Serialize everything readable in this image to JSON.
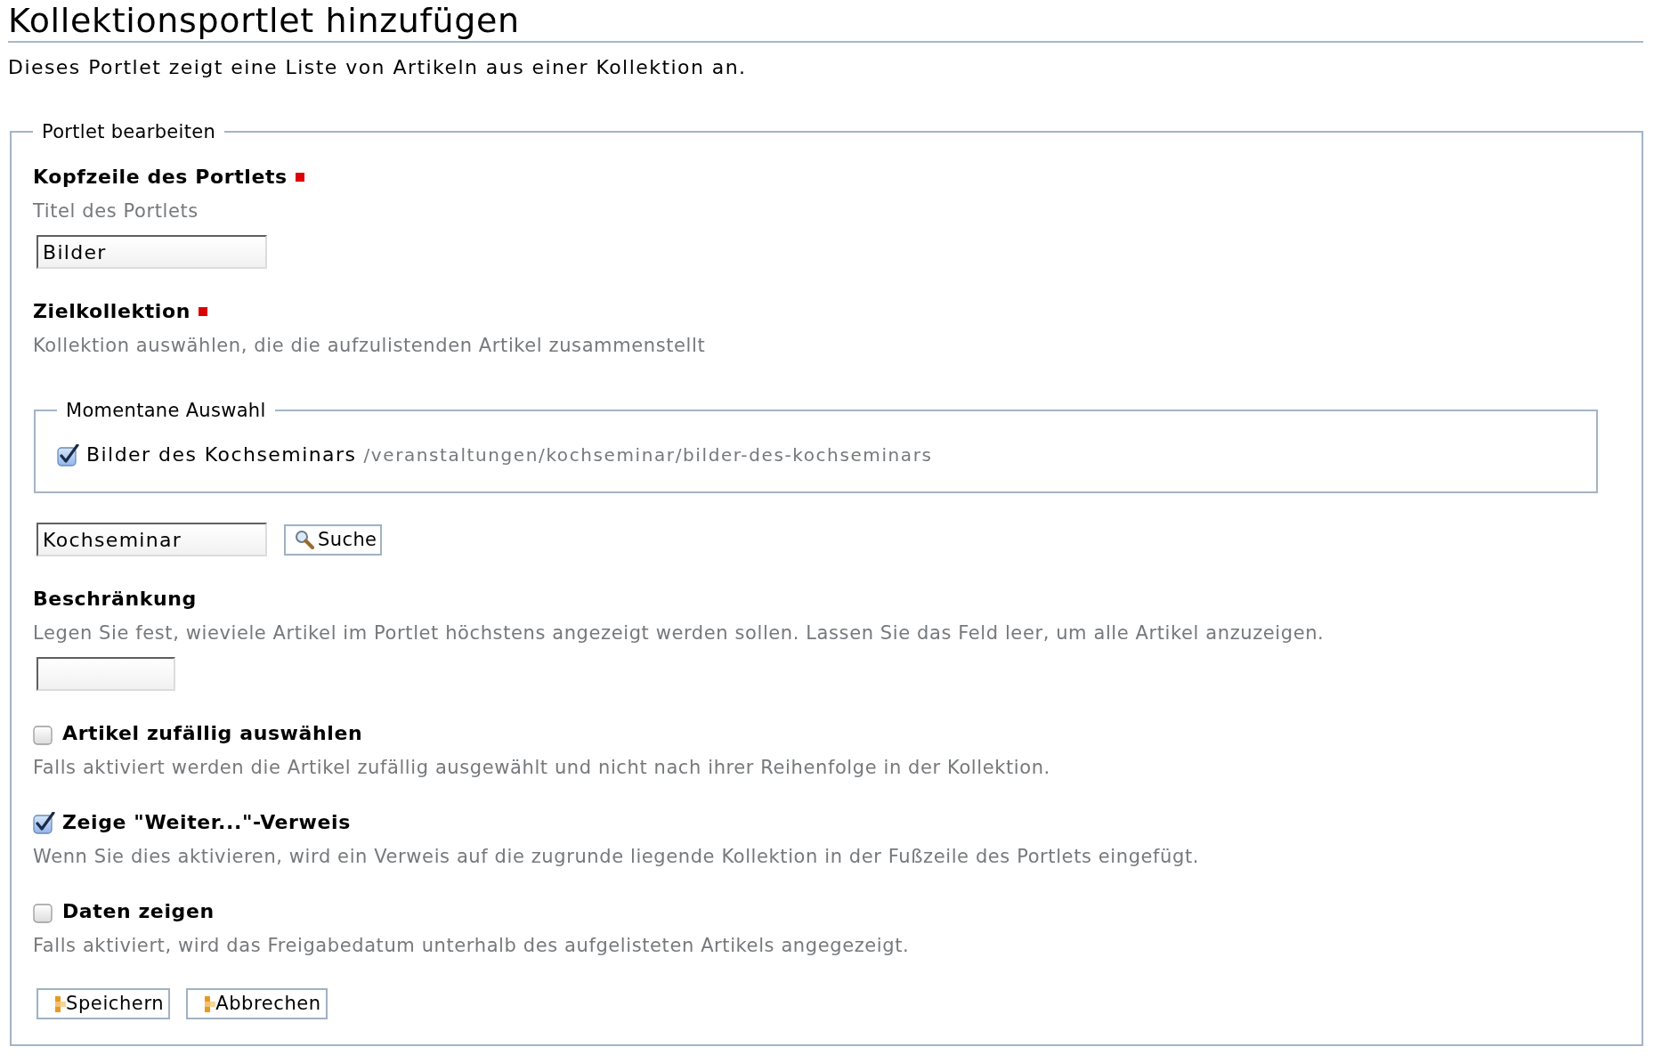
{
  "page": {
    "title": "Kollektionsportlet hinzufügen",
    "description": "Dieses Portlet zeigt eine Liste von Artikeln aus einer Kollektion an."
  },
  "form": {
    "legend": "Portlet bearbeiten",
    "fields": [
      {
        "kind": "text",
        "label": "Kopfzeile des Portlets",
        "required": true,
        "help": "Titel des Portlets",
        "value": "Bilder"
      },
      {
        "kind": "collection",
        "label": "Zielkollektion",
        "required": true,
        "help": "Kollektion auswählen, die die aufzulistenden Artikel zusammenstellt",
        "current_selection": {
          "legend": "Momentane Auswahl",
          "items": [
            {
              "title": "Bilder des Kochseminars",
              "path": "/veranstaltungen/kochseminar/bilder-des-kochseminars",
              "checked": true
            }
          ]
        },
        "search": {
          "value": "Kochseminar",
          "button": "Suche"
        }
      },
      {
        "kind": "number",
        "label": "Beschränkung",
        "help": "Legen Sie fest, wieviele Artikel im Portlet höchstens angezeigt werden sollen. Lassen Sie das Feld leer, um alle Artikel anzuzeigen."
      },
      {
        "kind": "checkbox",
        "label": "Artikel zufällig auswählen",
        "checked": false,
        "help": "Falls aktiviert werden die Artikel zufällig ausgewählt und nicht nach ihrer Reihenfolge in der Kollektion."
      },
      {
        "kind": "checkbox",
        "label": "Zeige \"Weiter...\"-Verweis",
        "checked": true,
        "help": "Wenn Sie dies aktivieren, wird ein Verweis auf die zugrunde liegende Kollektion in der Fußzeile des Portlets eingefügt."
      },
      {
        "kind": "checkbox",
        "label": "Daten zeigen",
        "checked": false,
        "help": "Falls aktiviert, wird das Freigabedatum unterhalb des aufgelisteten Artikels angegezeigt."
      }
    ],
    "buttons": [
      "Speichern",
      "Abbrechen"
    ]
  }
}
